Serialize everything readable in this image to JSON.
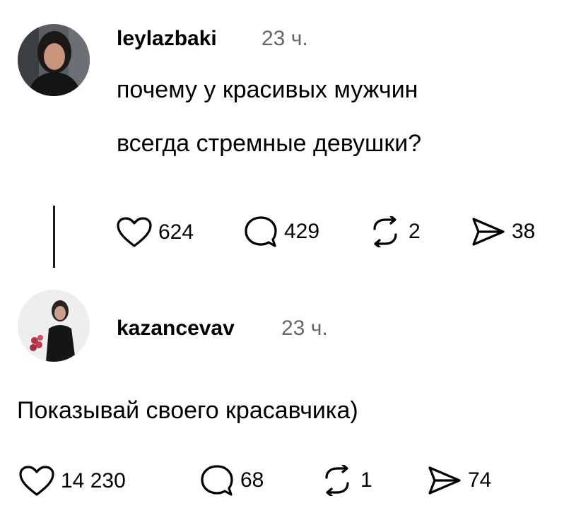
{
  "comments": [
    {
      "username": "leylazbaki",
      "time": "23 ч.",
      "text_lines": [
        "почему у красивых мужчин",
        "всегда стремные девушки?"
      ],
      "actions": {
        "likes": "624",
        "replies": "429",
        "reposts": "2",
        "shares": "38"
      }
    },
    {
      "username": "kazancevav",
      "time": "23 ч.",
      "text_lines": [
        "Показывай своего красавчика)"
      ],
      "actions": {
        "likes": "14 230",
        "replies": "68",
        "reposts": "1",
        "shares": "74"
      }
    }
  ],
  "icons": [
    "heart-icon",
    "comment-bubble-icon",
    "repost-icon",
    "share-send-icon"
  ]
}
